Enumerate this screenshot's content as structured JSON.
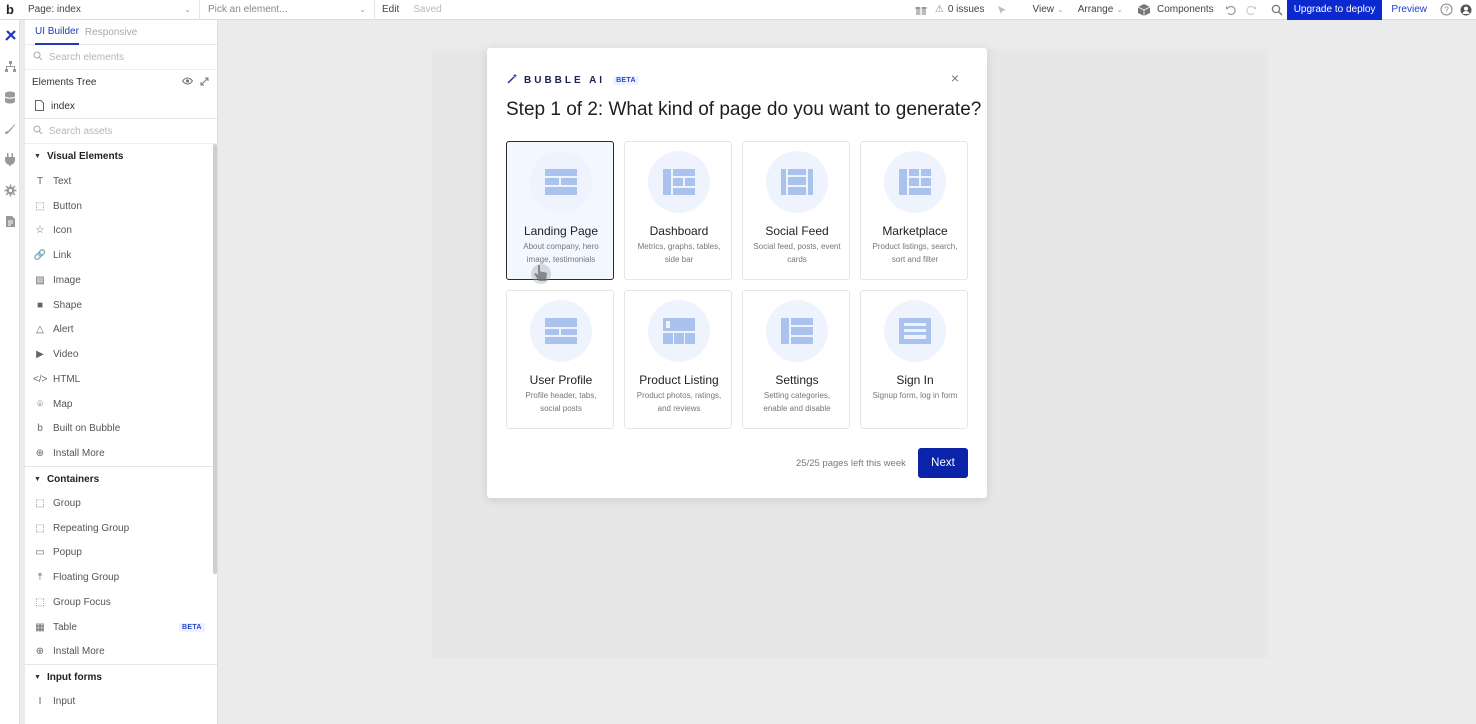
{
  "topbar": {
    "logo": "b",
    "page_select": "Page: index",
    "element_select": "Pick an element...",
    "edit": "Edit",
    "saved": "Saved",
    "issues": "0 issues",
    "view": "View",
    "arrange": "Arrange",
    "components": "Components",
    "upgrade": "Upgrade to deploy",
    "preview": "Preview",
    "chevron": "⌄",
    "warning_glyph": "⚠"
  },
  "panel": {
    "tabs": [
      "UI Builder",
      "Responsive"
    ],
    "search_elements_placeholder": "Search elements",
    "elements_tree": "Elements Tree",
    "tree_items": [
      "index"
    ],
    "search_assets_placeholder": "Search assets",
    "visual_section": "Visual Elements",
    "visual_items": [
      {
        "label": "Text",
        "icon": "T"
      },
      {
        "label": "Button",
        "icon": "⬚"
      },
      {
        "label": "Icon",
        "icon": "☆"
      },
      {
        "label": "Link",
        "icon": "🔗"
      },
      {
        "label": "Image",
        "icon": "▨"
      },
      {
        "label": "Shape",
        "icon": "■"
      },
      {
        "label": "Alert",
        "icon": "△"
      },
      {
        "label": "Video",
        "icon": "▶"
      },
      {
        "label": "HTML",
        "icon": "</>"
      },
      {
        "label": "Map",
        "icon": "⌾"
      },
      {
        "label": "Built on Bubble",
        "icon": "b"
      },
      {
        "label": "Install More",
        "icon": "⊕"
      }
    ],
    "containers_section": "Containers",
    "container_items": [
      {
        "label": "Group",
        "icon": "⬚"
      },
      {
        "label": "Repeating Group",
        "icon": "⬚"
      },
      {
        "label": "Popup",
        "icon": "▭"
      },
      {
        "label": "Floating Group",
        "icon": "⤒"
      },
      {
        "label": "Group Focus",
        "icon": "⬚"
      },
      {
        "label": "Table",
        "icon": "▦",
        "badge": "BETA"
      },
      {
        "label": "Install More",
        "icon": "⊕"
      }
    ],
    "input_section": "Input forms",
    "input_items": [
      {
        "label": "Input",
        "icon": "I"
      }
    ]
  },
  "modal": {
    "brand": "BUBBLE AI",
    "beta": "BETA",
    "close": "×",
    "title": "Step 1 of 2: What kind of page do you want to generate?",
    "cards": [
      {
        "name": "Landing Page",
        "desc": "About company, hero image, testimonials",
        "selected": true
      },
      {
        "name": "Dashboard",
        "desc": "Metrics, graphs, tables, side bar"
      },
      {
        "name": "Social Feed",
        "desc": "Social feed, posts, event cards"
      },
      {
        "name": "Marketplace",
        "desc": "Product listings, search, sort and filter"
      },
      {
        "name": "User Profile",
        "desc": "Profile header, tabs, social posts"
      },
      {
        "name": "Product Listing",
        "desc": "Product photos, ratings, and reviews"
      },
      {
        "name": "Settings",
        "desc": "Setting categories, enable and disable"
      },
      {
        "name": "Sign In",
        "desc": "Signup form, log in form"
      }
    ],
    "pages_left": "25/25 pages left this week",
    "next": "Next"
  },
  "colors": {
    "accent": "#0c29d0",
    "next_button": "#0b23a9",
    "card_illustration": "#a9c2ee"
  }
}
